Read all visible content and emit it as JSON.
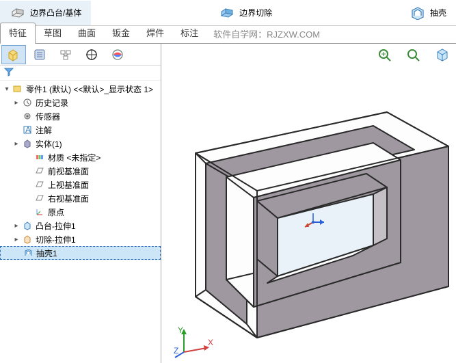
{
  "toolbar": {
    "boss_boundary": "边界凸台/基体",
    "cut_boundary": "边界切除",
    "shell": "抽壳"
  },
  "ribbon": {
    "tabs": [
      "特征",
      "草图",
      "曲面",
      "钣金",
      "焊件",
      "标注"
    ],
    "active": 0,
    "watermark": "软件自学网：RJZXW.COM"
  },
  "tree": {
    "root": "零件1 (默认) <<默认>_显示状态 1>",
    "items": [
      {
        "label": "历史记录",
        "icon": "history",
        "exp": "▸"
      },
      {
        "label": "传感器",
        "icon": "sensor",
        "exp": ""
      },
      {
        "label": "注解",
        "icon": "annot",
        "exp": ""
      },
      {
        "label": "实体(1)",
        "icon": "solid",
        "exp": "▸"
      },
      {
        "label": "材质 <未指定>",
        "icon": "material",
        "exp": ""
      },
      {
        "label": "前视基准面",
        "icon": "plane",
        "exp": ""
      },
      {
        "label": "上视基准面",
        "icon": "plane",
        "exp": ""
      },
      {
        "label": "右视基准面",
        "icon": "plane",
        "exp": ""
      },
      {
        "label": "原点",
        "icon": "origin",
        "exp": ""
      },
      {
        "label": "凸台-拉伸1",
        "icon": "extrude",
        "exp": "▸"
      },
      {
        "label": "切除-拉伸1",
        "icon": "cut",
        "exp": "▸"
      },
      {
        "label": "抽壳1",
        "icon": "shell",
        "exp": "",
        "sel": true
      }
    ]
  },
  "triad": {
    "x": "X",
    "y": "Y",
    "z": "Z"
  }
}
